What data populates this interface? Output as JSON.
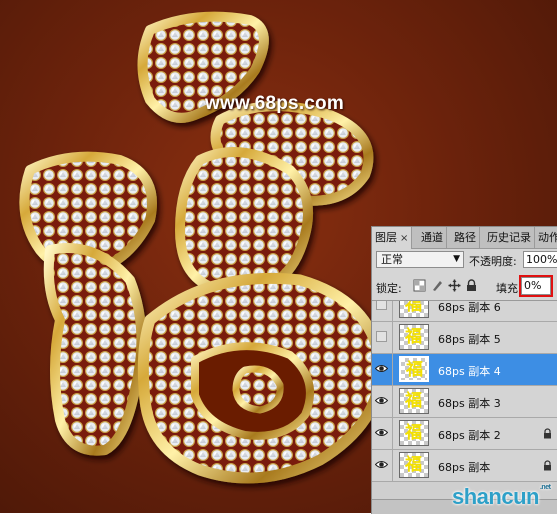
{
  "artwork": {
    "watermark": "www.68ps.com",
    "character_icon": "fu-character-gold-diamond-artwork"
  },
  "layers_panel": {
    "tabs": [
      {
        "label": "图层",
        "close": "×"
      },
      {
        "label": "通道"
      },
      {
        "label": "路径"
      },
      {
        "label": "历史记录"
      },
      {
        "label": "动作"
      }
    ],
    "blend_mode": "正常",
    "opacity_label": "不透明度:",
    "opacity_value": "100%",
    "lock_label": "锁定:",
    "fill_label": "填充:",
    "fill_value": "0%",
    "layers": [
      {
        "name": "68ps 副本 6",
        "visible": false,
        "selected": false,
        "locked": false
      },
      {
        "name": "68ps 副本 5",
        "visible": false,
        "selected": false,
        "locked": false
      },
      {
        "name": "68ps 副本 4",
        "visible": true,
        "selected": true,
        "locked": false
      },
      {
        "name": "68ps 副本 3",
        "visible": true,
        "selected": false,
        "locked": false
      },
      {
        "name": "68ps 副本 2",
        "visible": true,
        "selected": false,
        "locked": true
      },
      {
        "name": "68ps 副本",
        "visible": true,
        "selected": false,
        "locked": true
      }
    ],
    "thumb_glyph": "福",
    "colors": {
      "selected": "#3d8ee4",
      "highlight": "#e01010"
    }
  },
  "site_badge": {
    "text": "shancun",
    "small": ".net"
  }
}
